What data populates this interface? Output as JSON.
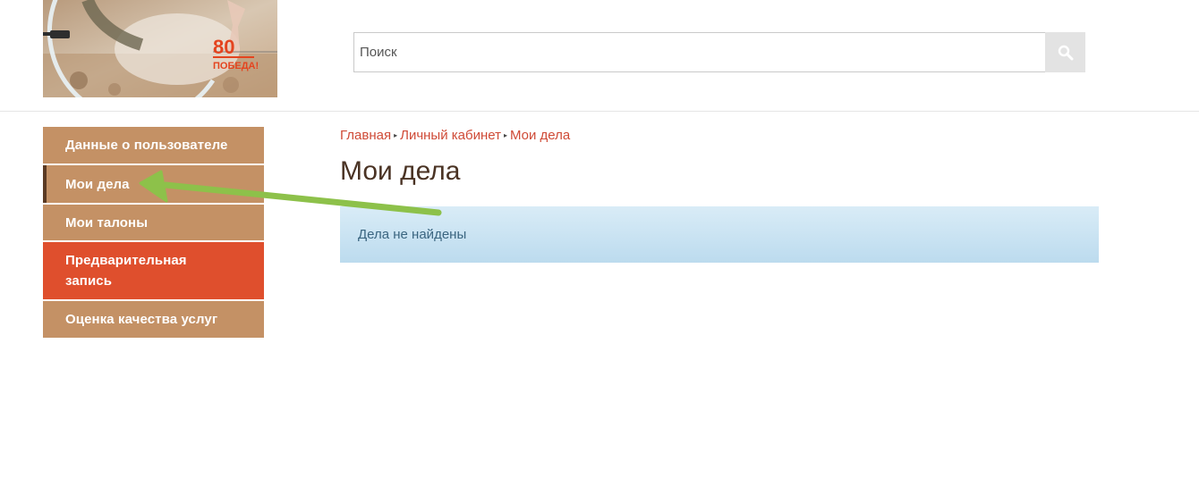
{
  "banner": {
    "badge_number": "80",
    "badge_text": "ПОБЕДА!"
  },
  "search": {
    "placeholder": "Поиск",
    "value": ""
  },
  "sidebar": {
    "items": [
      {
        "label": "Данные о пользователе",
        "state": "default"
      },
      {
        "label": "Мои дела",
        "state": "selected"
      },
      {
        "label": "Мои талоны",
        "state": "default"
      },
      {
        "label": "Предварительная запись",
        "state": "highlighted"
      },
      {
        "label": "Оценка качества услуг",
        "state": "default"
      }
    ]
  },
  "breadcrumb": {
    "items": [
      "Главная",
      "Личный кабинет",
      "Мои дела"
    ]
  },
  "main": {
    "title": "Мои дела",
    "empty_message": "Дела не найдены"
  },
  "colors": {
    "menu_item": "#c49165",
    "menu_highlight": "#df4f2d",
    "link": "#cf4a36",
    "title": "#4a3324",
    "alert_bg": "#c9e3f2",
    "annotation_arrow": "#8dc14a"
  }
}
